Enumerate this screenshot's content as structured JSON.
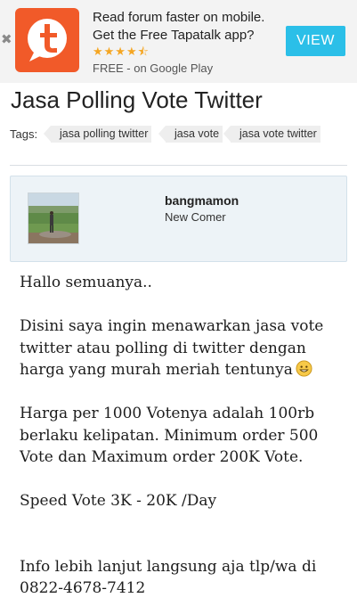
{
  "banner": {
    "close_icon": "close-icon",
    "app_icon": "tapatalk-icon",
    "line1": "Read forum faster on mobile.",
    "line2": "Get the Free Tapatalk app?",
    "stars": "★★★★⯪",
    "rating": 4.5,
    "line3": "FREE - on Google Play",
    "view_label": "VIEW",
    "accent": "#2bbfe8",
    "brand": "#f15a29"
  },
  "thread": {
    "title": "Jasa Polling Vote Twitter",
    "tags_label": "Tags:",
    "tags": [
      "jasa polling twitter",
      "jasa vote",
      "jasa vote twitter"
    ]
  },
  "author": {
    "name": "bangmamon",
    "rank": "New Comer",
    "avatar": "user-photo"
  },
  "post": {
    "p1": "Hallo semuanya..",
    "p2": "Disini saya ingin menawarkan jasa vote twitter atau polling di twitter dengan harga yang murah meriah tentunya",
    "emoji": "smiley-icon",
    "p3": "Harga per 1000 Votenya adalah 100rb berlaku kelipatan. Minimum order 500 Vote dan Maximum order 200K Vote.",
    "p4": "Speed Vote 3K - 20K /Day",
    "p5": "Info lebih lanjut langsung aja tlp/wa di 0822-4678-7412"
  }
}
